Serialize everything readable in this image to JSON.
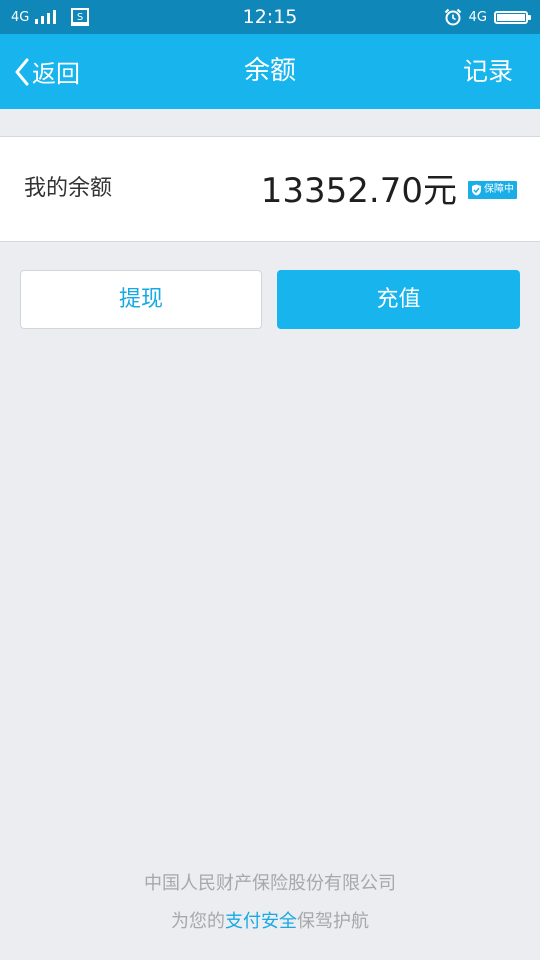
{
  "status_bar": {
    "network_left": "4G",
    "time": "12:15",
    "network_right": "4G"
  },
  "nav": {
    "back_label": "返回",
    "title": "余额",
    "records_label": "记录"
  },
  "balance": {
    "label": "我的余额",
    "amount": "13352.70元",
    "badge": "保障中"
  },
  "actions": {
    "withdraw_label": "提现",
    "recharge_label": "充值"
  },
  "footer": {
    "company": "中国人民财产保险股份有限公司",
    "slogan_prefix": "为您的",
    "slogan_highlight": "支付安全",
    "slogan_suffix": "保驾护航"
  },
  "colors": {
    "status_bar": "#0f87b8",
    "nav_bar": "#17b4ee",
    "accent": "#17a9e4",
    "background": "#ecedf1"
  }
}
